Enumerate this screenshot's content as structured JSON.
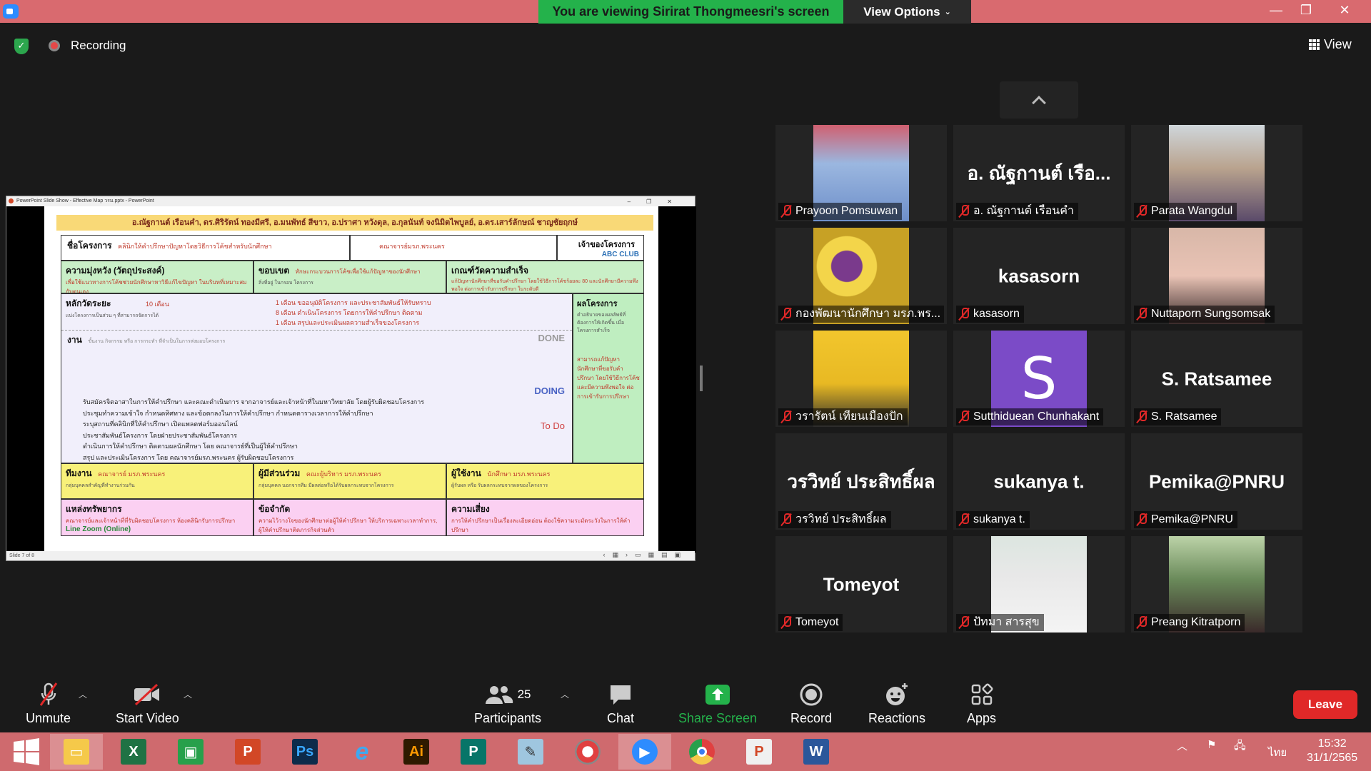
{
  "titlebar": {
    "banner": "You are viewing Sirirat Thongmeesri's screen",
    "view_options": "View Options",
    "minimize": "—",
    "restore": "❐",
    "close": "✕"
  },
  "header": {
    "recording": "Recording",
    "view": "View"
  },
  "shared_screen": {
    "window_title": "PowerPoint Slide Show - Effective Map วรม.pptx - PowerPoint",
    "status_left": "Slide 7 of 8",
    "slide": {
      "authors": "อ.ณัฐกานต์ เรือนคำ, ดร.ศิริรัตน์ ทองมีศรี, อ.มนพัทธ์ สีขาว, อ.ปราศา หวังดุล, อ.กุลนันท์ จงนิมิตไพบูลย์, อ.ดร.เสาร์ลักษณ์ ชาญชัยฤกษ์",
      "project_label": "ชื่อโครงการ",
      "project_value": "คลินิกให้คำปรึกษาปัญหาโดยวิธีการโค้ชสำหรับนักศึกษา",
      "faculty": "คณาจารย์มรภ.พระนคร",
      "owner_label": "เจ้าของโครงการ",
      "owner_value": "ABC CLUB",
      "goal_label": "ความมุ่งหวัง (วัตถุประสงค์)",
      "goal_text": "เพื่อใช้แนวทางการโค้ชช่วยนักศึกษาหาวิธีแก้ไขปัญหา ในบริบทที่เหมาะสมกับตนเอง",
      "scope_label": "ขอบเขต",
      "scope_text": "ทักษะกระบวนการโค้ชเพื่อใช้แก้ปัญหาของนักศึกษา",
      "scope_sub": "สิ่งที่อยู่ ในกรอบ โครงการ",
      "kpi_label": "เกณฑ์วัดความสำเร็จ",
      "kpi_text": "แก้ปัญหานักศึกษาที่ขอรับคำปรึกษา โดยใช้วิธีการโค้ชร้อยละ 80 และนักศึกษามีความพึงพอใจ ต่อการเข้ารับการปรึกษา ในระดับดี",
      "duration_label": "หลักวัดระยะ",
      "duration_value": "10 เดือน",
      "duration_sub": "แบ่งโครงการเป็นส่วน ๆ ที่สามารถจัดการได้",
      "milestone_1": "1 เดือน ขออนุมัติโครงการ และประชาสัมพันธ์ให้รับทราบ",
      "milestone_2": "8 เดือน ดำเนินโครงการ โดยการให้คำปรึกษา ติดตาม",
      "milestone_3": "1 เดือน สรุปและประเมินผลความสำเร็จของโครงการ",
      "result_label": "ผลโครงการ",
      "result_sub": "คำอธิบายของผลลัพธ์ที่ต้องการให้เกิดขึ้น เมื่อโครงการสำเร็จ",
      "result_text": "สามารถแก้ปัญหานักศึกษาที่ขอรับคำปรึกษา โดยใช้วิธีการโค้ชและมีความพึงพอใจ ต่อการเข้ารับการปรึกษา",
      "work_label": "งาน",
      "work_sub": "ขั้นงาน กิจกรรม หรือ การกระทำ ที่จำเป็นในการส่งมอบโครงการ",
      "done": "DONE",
      "doing": "DOING",
      "todo": "To Do",
      "tasks": [
        "รับสมัครจิตอาสาในการให้คำปรึกษา และคณะดำเนินการ จากอาจารย์และเจ้าหน้าที่ในมหาวิทยาลัย โดยผู้รับผิดชอบโครงการ",
        "ประชุมทำความเข้าใจ กำหนดทิศทาง และข้อตกลงในการให้คำปรึกษา กำหนดตารางเวลาการให้คำปรึกษา",
        "ระบุสถานที่คลินิกที่ให้คำปรึกษา เปิดแพลตฟอร์มออนไลน์",
        "ประชาสัมพันธ์โครงการ โดยฝ่ายประชาสัมพันธ์โครงการ",
        "ดำเนินการให้คำปรึกษา ติดตามผลนักศึกษา โดย คณาจารย์ที่เป็นผู้ให้คำปรึกษา",
        "สรุป และประเมินโครงการ โดย คณาจารย์มรภ.พระนคร ผู้รับผิดชอบโครงการ"
      ],
      "team_label": "ทีมงาน",
      "team_value": "คณาจารย์ มรภ.พระนคร",
      "team_sub": "กลุ่มบุคคลสำคัญที่ทำงานร่วมกัน",
      "stake_label": "ผู้มีส่วนร่วม",
      "stake_value": "คณะผู้บริหาร มรภ.พระนคร",
      "stake_sub": "กลุ่มบุคคล นอกจากทีม มีผลต่อหรือได้รับผลกระทบจากโครงการ",
      "user_label": "ผู้ใช้งาน",
      "user_value": "นักศึกษา มรภ.พระนคร",
      "user_sub": "ผู้รับผล หรือ รับผลกระทบจากผลของโครงการ",
      "resource_label": "แหล่งทรัพยากร",
      "resource_text": "คณาจารย์และเจ้าหน้าที่ที่รับผิดชอบโครงการ ห้องคลินิกรับการปรึกษา",
      "resource_online": "Line Zoom (Online)",
      "limit_label": "ข้อจำกัด",
      "limit_text": "ความไว้วางใจของนักศึกษาต่อผู้ให้คำปรึกษา ให้บริการเฉพาะเวลาทำการ, ผู้ให้คำปรึกษาติดภารกิจส่วนตัว",
      "risk_label": "ความเสี่ยง",
      "risk_text": "การให้คำปรึกษาเป็นเรื่องละเอียดอ่อน ต้องใช้ความระมัดระวังในการให้คำปรึกษา"
    }
  },
  "participants": [
    {
      "name": "Prayoon Pomsuwan",
      "display": "",
      "photo": "ph-blue"
    },
    {
      "name": "อ. ณัฐกานต์ เรือนคำ",
      "display": "อ. ณัฐกานต์ เรือ...",
      "photo": ""
    },
    {
      "name": "Parata Wangdul",
      "display": "",
      "photo": "ph-woman"
    },
    {
      "name": "กองพัฒนานักศึกษา มรภ.พร...",
      "display": "",
      "photo": "ph-logo"
    },
    {
      "name": "kasasorn",
      "display": "kasasorn",
      "photo": ""
    },
    {
      "name": "Nuttaporn Sungsomsak",
      "display": "",
      "photo": "ph-girl"
    },
    {
      "name": "วรารัตน์ เทียนเมืองปัก",
      "display": "",
      "photo": "ph-yellow"
    },
    {
      "name": "Sutthiduean Chunhakant",
      "display": "",
      "photo": "avatar",
      "avatar_letter": "S"
    },
    {
      "name": "S. Ratsamee",
      "display": "S. Ratsamee",
      "photo": ""
    },
    {
      "name": "วรวิทย์ ประสิทธิ์ผล",
      "display": "วรวิทย์ ประสิทธิ์ผล",
      "photo": ""
    },
    {
      "name": "sukanya t.",
      "display": "sukanya t.",
      "photo": ""
    },
    {
      "name": "Pemika@PNRU",
      "display": "Pemika@PNRU",
      "photo": ""
    },
    {
      "name": "Tomeyot",
      "display": "Tomeyot",
      "photo": ""
    },
    {
      "name": "ปัทมา สารสุข",
      "display": "",
      "photo": "ph-uniform"
    },
    {
      "name": "Preang Kitratporn",
      "display": "",
      "photo": "ph-man"
    }
  ],
  "toolbar": {
    "unmute": "Unmute",
    "start_video": "Start Video",
    "participants": "Participants",
    "participants_count": "25",
    "chat": "Chat",
    "share_screen": "Share Screen",
    "record": "Record",
    "reactions": "Reactions",
    "apps": "Apps",
    "leave": "Leave"
  },
  "taskbar": {
    "apps": [
      "start",
      "file-explorer",
      "excel",
      "store",
      "powerpoint",
      "photoshop",
      "internet-explorer",
      "illustrator",
      "publisher",
      "notepad",
      "photoscape",
      "zoom",
      "chrome",
      "powerpoint-2",
      "word"
    ],
    "language": "ไทย",
    "time": "15:32",
    "date": "31/1/2565"
  },
  "colors": {
    "banner_green": "#24b24b",
    "titlebar_red": "#d96a6f",
    "leave_red": "#e02828",
    "share_green": "#24b24b"
  }
}
